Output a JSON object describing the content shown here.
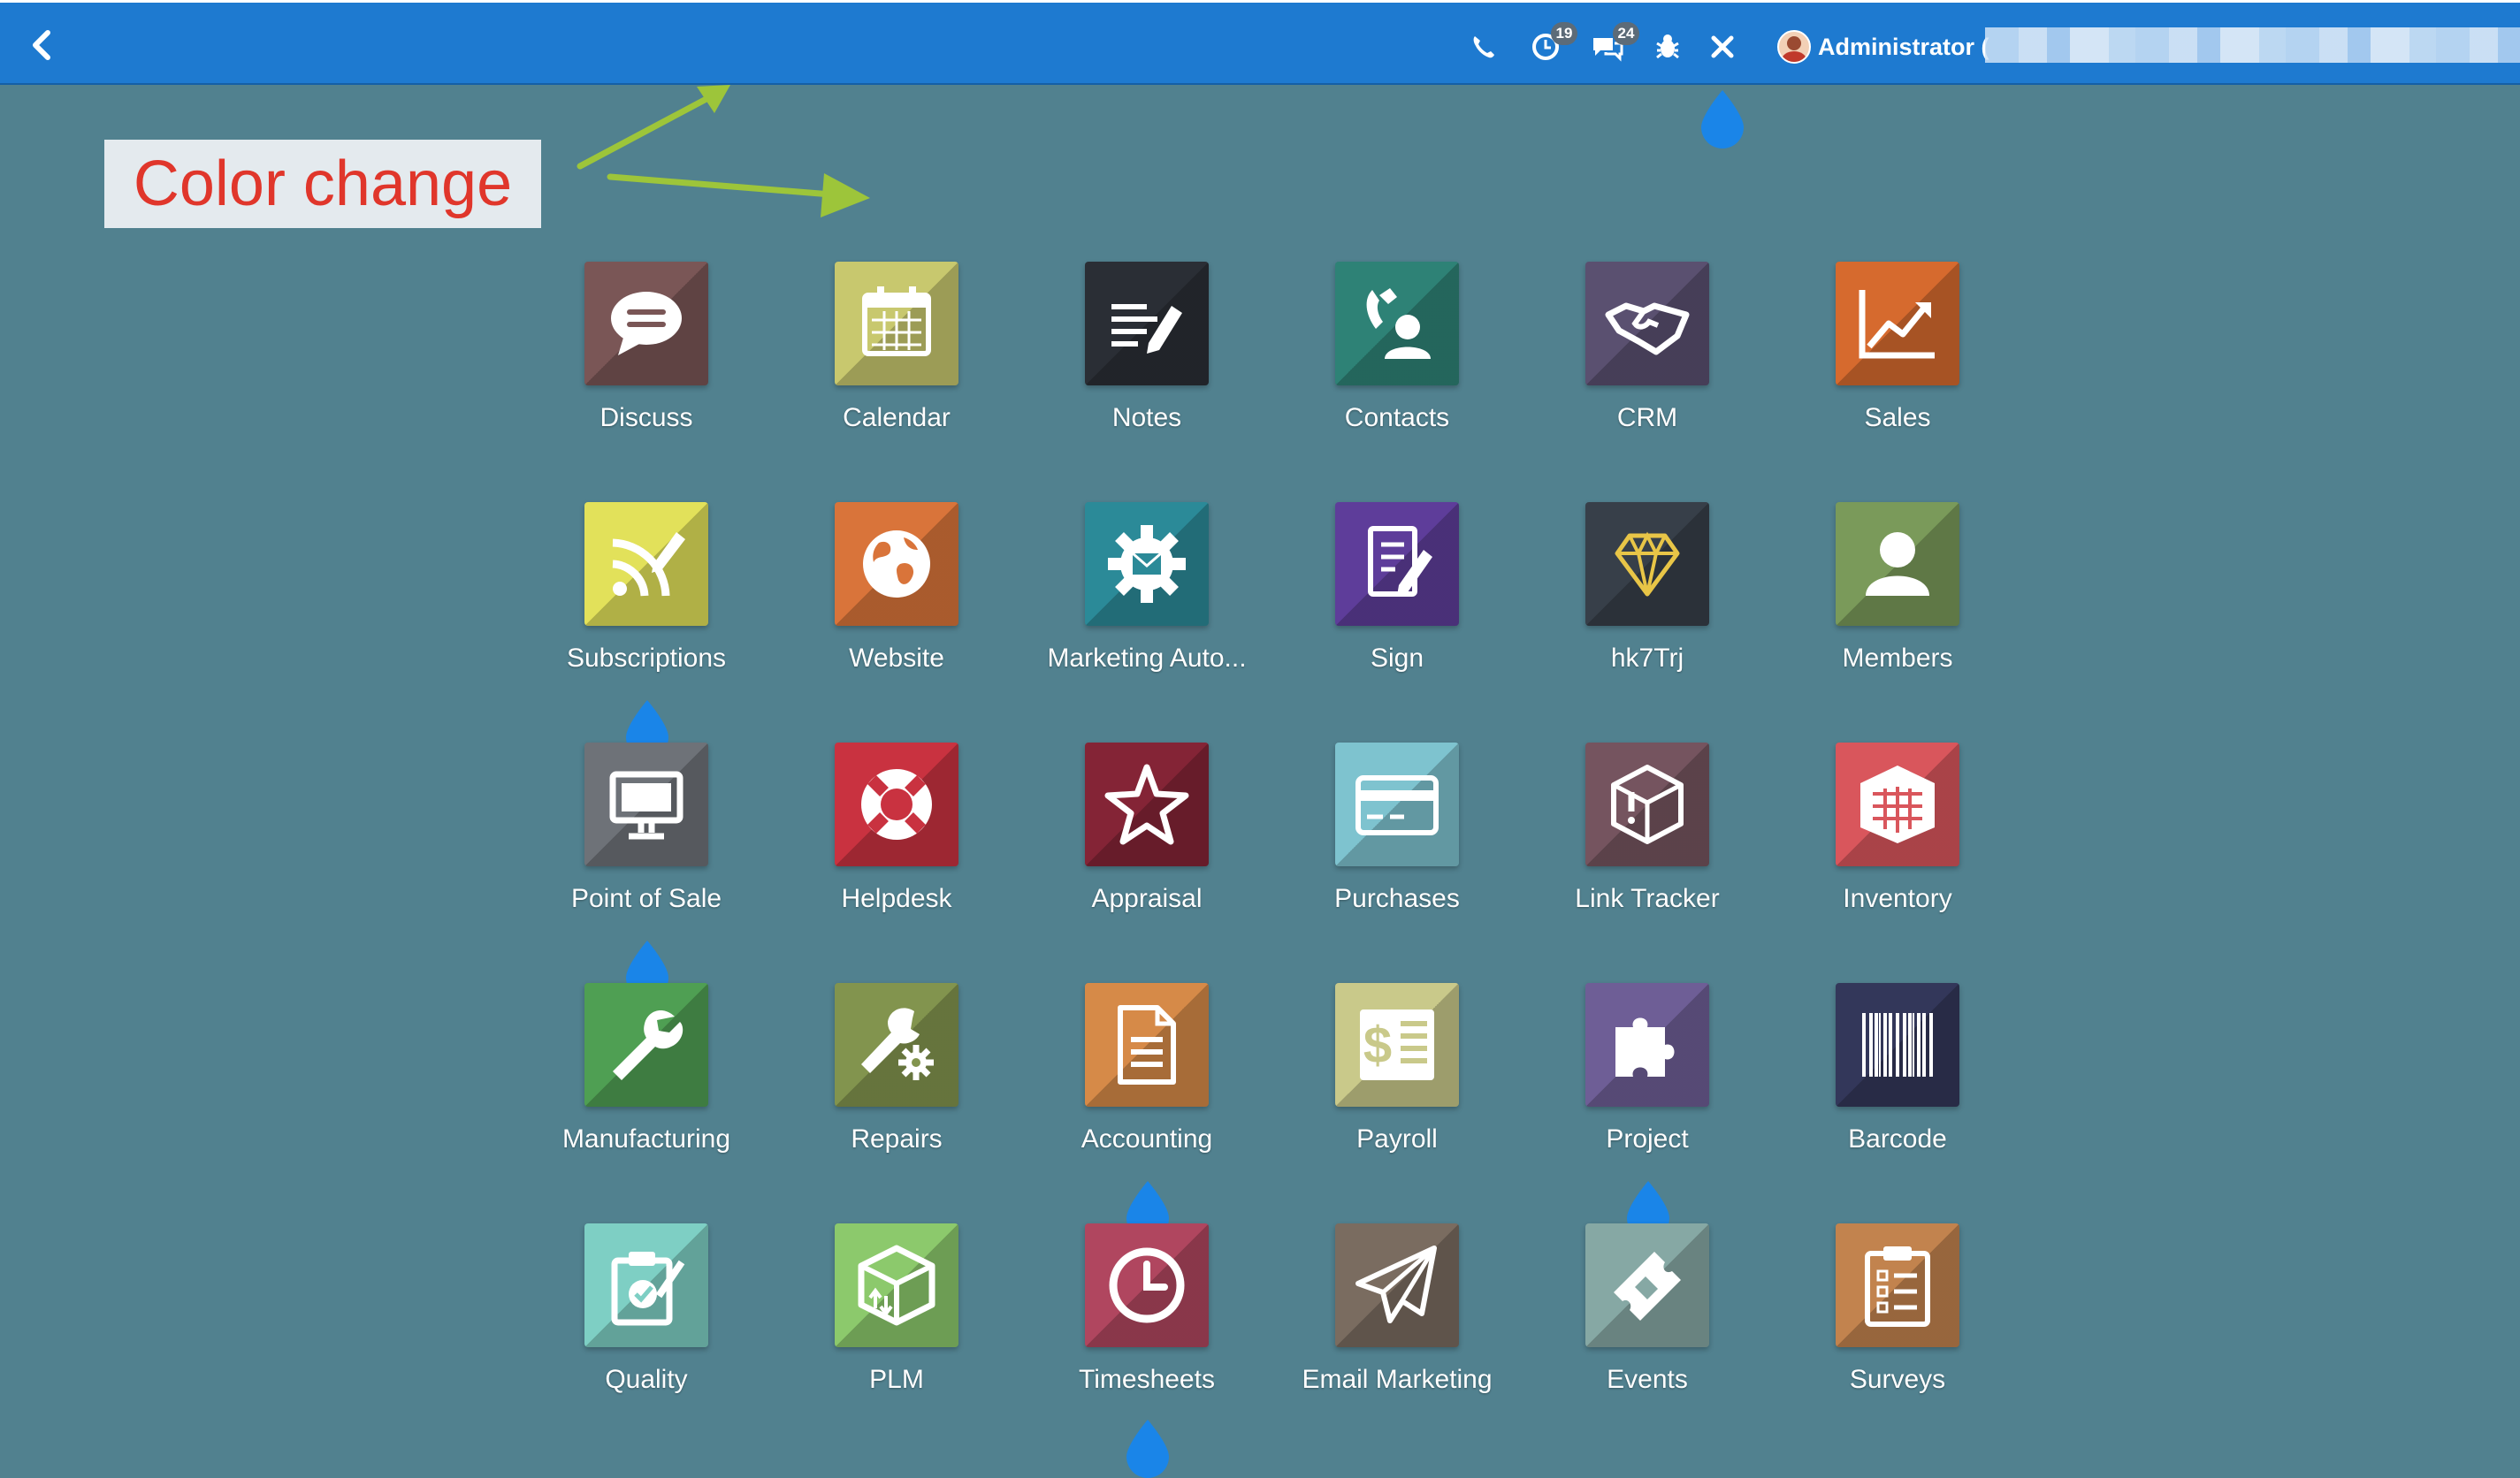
{
  "topbar": {
    "badge_activities": "19",
    "badge_messages": "24",
    "user_name": "Administrator ("
  },
  "annotation": {
    "text": "Color change"
  },
  "apps": [
    {
      "label": "Discuss",
      "icon": "chat-bubble-icon",
      "color": "#7a5656"
    },
    {
      "label": "Calendar",
      "icon": "calendar-icon",
      "color": "#c8c86e"
    },
    {
      "label": "Notes",
      "icon": "notes-pencil-icon",
      "color": "#2a2e35"
    },
    {
      "label": "Contacts",
      "icon": "contact-phone-icon",
      "color": "#2e8276"
    },
    {
      "label": "CRM",
      "icon": "handshake-icon",
      "color": "#5a5070"
    },
    {
      "label": "Sales",
      "icon": "trend-chart-icon",
      "color": "#d66a2e"
    },
    {
      "label": "Subscriptions",
      "icon": "rss-pencil-icon",
      "color": "#e2e15a"
    },
    {
      "label": "Website",
      "icon": "globe-icon",
      "color": "#d9743a"
    },
    {
      "label": "Marketing Auto...",
      "icon": "gear-mail-icon",
      "color": "#2b8a98"
    },
    {
      "label": "Sign",
      "icon": "sign-document-icon",
      "color": "#5e3d9a"
    },
    {
      "label": "hk7Trj",
      "icon": "diamond-icon",
      "color": "#373f49"
    },
    {
      "label": "Members",
      "icon": "member-user-icon",
      "color": "#7a9a5a"
    },
    {
      "label": "Point of Sale",
      "icon": "monitor-icon",
      "color": "#6e7278"
    },
    {
      "label": "Helpdesk",
      "icon": "lifebuoy-icon",
      "color": "#c93240"
    },
    {
      "label": "Appraisal",
      "icon": "star-icon",
      "color": "#842436"
    },
    {
      "label": "Purchases",
      "icon": "credit-card-icon",
      "color": "#7ec3cf"
    },
    {
      "label": "Link Tracker",
      "icon": "box-alert-icon",
      "color": "#75545f"
    },
    {
      "label": "Inventory",
      "icon": "warehouse-icon",
      "color": "#d9565c"
    },
    {
      "label": "Manufacturing",
      "icon": "wrench-icon",
      "color": "#4f9f53"
    },
    {
      "label": "Repairs",
      "icon": "wrench-gear-icon",
      "color": "#82944e"
    },
    {
      "label": "Accounting",
      "icon": "document-icon",
      "color": "#d68a48"
    },
    {
      "label": "Payroll",
      "icon": "dollar-sheet-icon",
      "color": "#c9c98a"
    },
    {
      "label": "Project",
      "icon": "puzzle-icon",
      "color": "#6e5e96"
    },
    {
      "label": "Barcode",
      "icon": "barcode-icon",
      "color": "#33375a"
    },
    {
      "label": "Quality",
      "icon": "quality-check-icon",
      "color": "#7ecfc4"
    },
    {
      "label": "PLM",
      "icon": "package-arrows-icon",
      "color": "#8cc96c"
    },
    {
      "label": "Timesheets",
      "icon": "clock-icon",
      "color": "#b0465f"
    },
    {
      "label": "Email Marketing",
      "icon": "paper-plane-icon",
      "color": "#7a6c60"
    },
    {
      "label": "Events",
      "icon": "ticket-icon",
      "color": "#86a8a4"
    },
    {
      "label": "Surveys",
      "icon": "clipboard-list-icon",
      "color": "#c2834e"
    }
  ]
}
